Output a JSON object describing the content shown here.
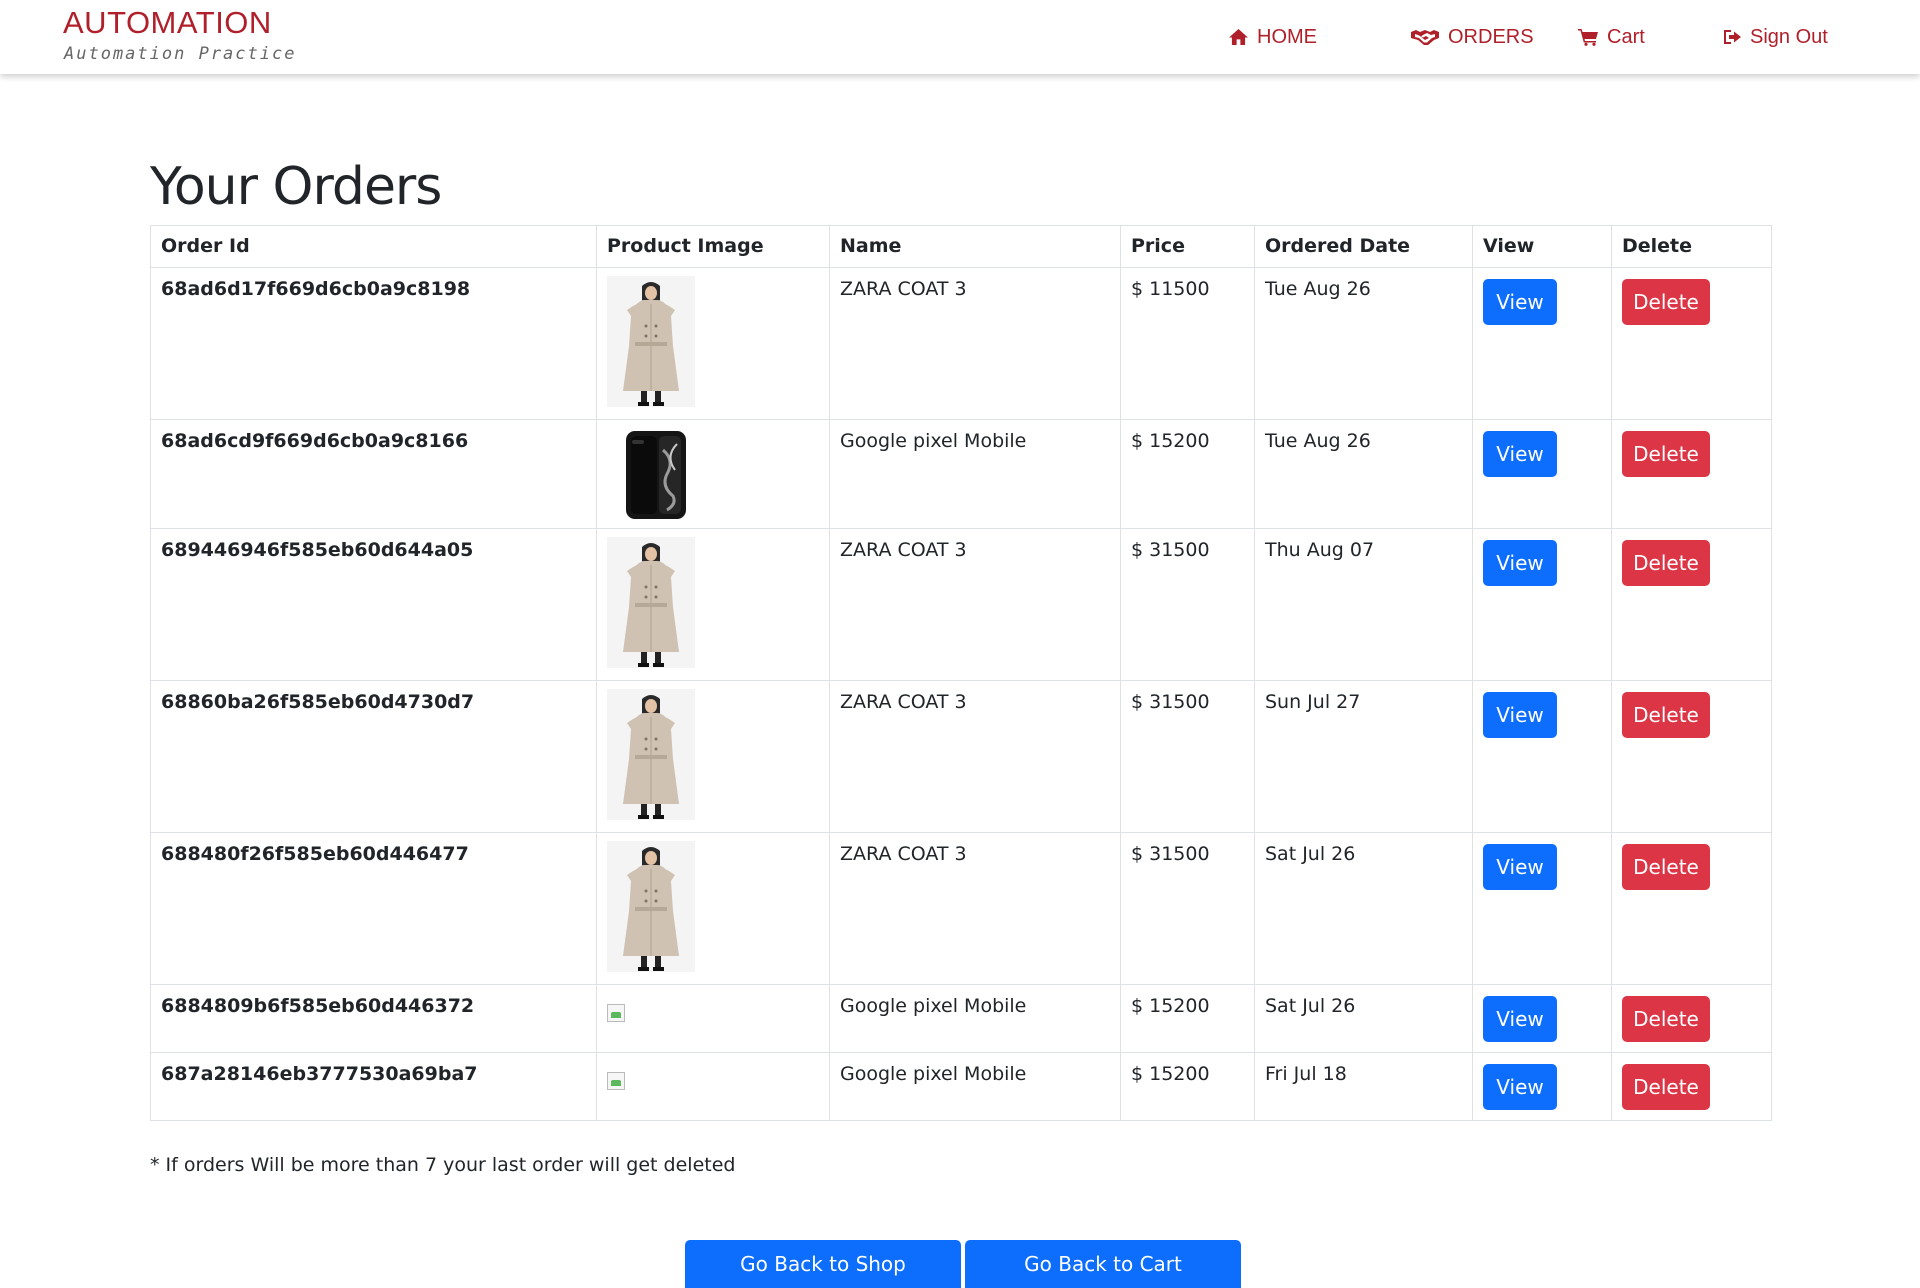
{
  "brand": {
    "title": "AUTOMATION",
    "subtitle": "Automation Practice"
  },
  "nav": {
    "home": "HOME",
    "orders": "ORDERS",
    "cart": "Cart",
    "signout": "Sign Out"
  },
  "page_title": "Your Orders",
  "table": {
    "headers": [
      "Order Id",
      "Product Image",
      "Name",
      "Price",
      "Ordered Date",
      "View",
      "Delete"
    ],
    "rows": [
      {
        "id": "68ad6d17f669d6cb0a9c8198",
        "image": "coat",
        "name": "ZARA COAT 3",
        "price": "$ 11500",
        "date": "Tue Aug 26",
        "view": "View",
        "delete": "Delete"
      },
      {
        "id": "68ad6cd9f669d6cb0a9c8166",
        "image": "phone",
        "name": "Google pixel Mobile",
        "price": "$ 15200",
        "date": "Tue Aug 26",
        "view": "View",
        "delete": "Delete"
      },
      {
        "id": "689446946f585eb60d644a05",
        "image": "coat",
        "name": "ZARA COAT 3",
        "price": "$ 31500",
        "date": "Thu Aug 07",
        "view": "View",
        "delete": "Delete"
      },
      {
        "id": "68860ba26f585eb60d4730d7",
        "image": "coat",
        "name": "ZARA COAT 3",
        "price": "$ 31500",
        "date": "Sun Jul 27",
        "view": "View",
        "delete": "Delete"
      },
      {
        "id": "688480f26f585eb60d446477",
        "image": "coat",
        "name": "ZARA COAT 3",
        "price": "$ 31500",
        "date": "Sat Jul 26",
        "view": "View",
        "delete": "Delete"
      },
      {
        "id": "6884809b6f585eb60d446372",
        "image": "broken",
        "name": "Google pixel Mobile",
        "price": "$ 15200",
        "date": "Sat Jul 26",
        "view": "View",
        "delete": "Delete"
      },
      {
        "id": "687a28146eb3777530a69ba7",
        "image": "broken",
        "name": "Google pixel Mobile",
        "price": "$ 15200",
        "date": "Fri Jul 18",
        "view": "View",
        "delete": "Delete"
      }
    ]
  },
  "note": "* If orders Will be more than 7 your last order will get deleted",
  "buttons": {
    "shop": "Go Back to Shop",
    "cart": "Go Back to Cart"
  },
  "colors": {
    "brand_red": "#b0202a",
    "primary": "#0d6efd",
    "danger": "#dc3545"
  }
}
